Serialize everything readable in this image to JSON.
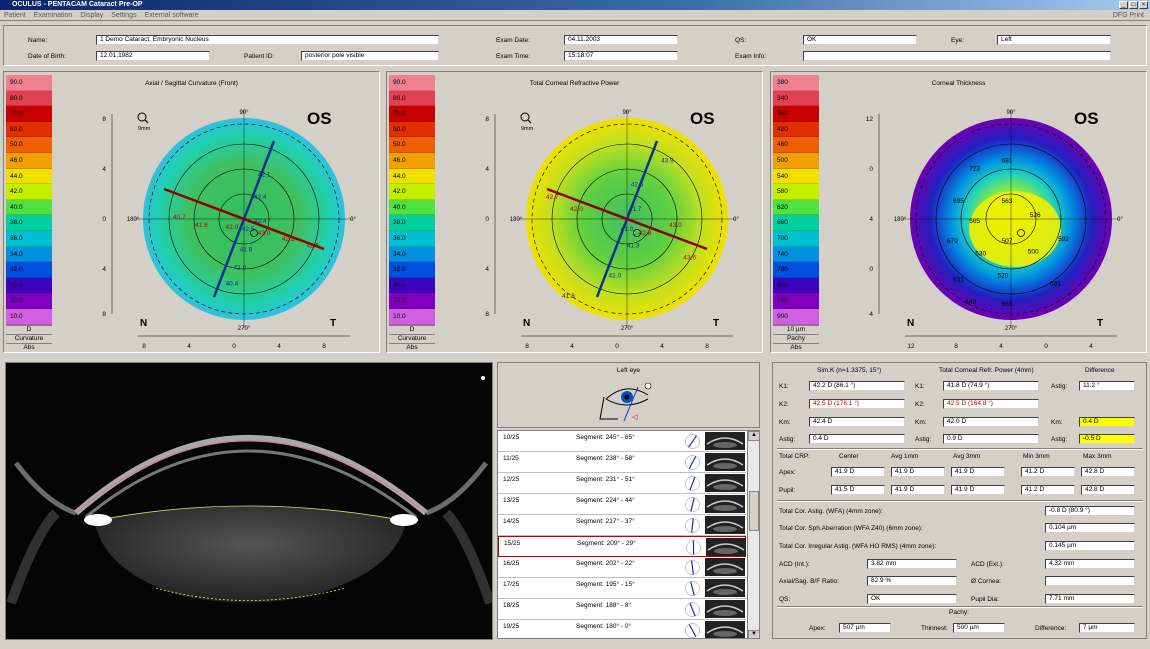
{
  "window": {
    "title": "OCULUS - PENTACAM  Cataract Pre-OP"
  },
  "menu": [
    "Patient",
    "Examination",
    "Display",
    "Settings",
    "External software"
  ],
  "menu_right": "DFG  Print",
  "header": {
    "name_label": "Name:",
    "name": "1 Demo Cataract, Embryonic Nucleus",
    "dob_label": "Date of Birth:",
    "dob": "12.01.1982",
    "pid_label": "Patient ID:",
    "pid": "posterior pole visible",
    "exam_date_label": "Exam Date:",
    "exam_date": "04.11.2003",
    "exam_time_label": "Exam Time:",
    "exam_time": "15:18:07",
    "qs_label": "QS:",
    "qs": "OK",
    "eye_label": "Eye:",
    "eye": "Left",
    "exam_info_label": "Exam Info:",
    "exam_info": ""
  },
  "maps": [
    {
      "title": "Axial / Sagittal Curvature (Front)",
      "os": "OS",
      "scale": [
        "90.0",
        "80.0",
        "70.0",
        "60.0",
        "50.0",
        "46.0",
        "44.0",
        "42.0",
        "40.0",
        "38.0",
        "36.0",
        "34.0",
        "32.0",
        "30.0",
        "20.0",
        "10.0"
      ],
      "foot": [
        "D",
        "Curvature",
        "Abs"
      ],
      "nasal": "N",
      "temporal": "T",
      "yticks": [
        "8",
        "4",
        "0",
        "4",
        "8"
      ],
      "xticks": [
        "8",
        "4",
        "0",
        "4",
        "8"
      ],
      "zoom": "9mm",
      "labels": [
        "42.1",
        "42.4",
        "42.4",
        "42.5",
        "41.8",
        "41.0",
        "40.4",
        "40.7",
        "41.6",
        "42.0",
        "43.0",
        "42.8",
        "42.5"
      ]
    },
    {
      "title": "Total Corneal Refractive Power",
      "os": "OS",
      "scale": [
        "90.0",
        "80.0",
        "70.0",
        "60.0",
        "50.0",
        "46.0",
        "44.0",
        "42.0",
        "40.0",
        "38.0",
        "36.0",
        "34.0",
        "32.0",
        "30.0",
        "20.0",
        "10.0"
      ],
      "foot": [
        "D",
        "Curvature",
        "Abs"
      ],
      "nasal": "N",
      "temporal": "T",
      "yticks": [
        "8",
        "4",
        "0",
        "4",
        "8"
      ],
      "xticks": [
        "8",
        "4",
        "0",
        "4",
        "8"
      ],
      "zoom": "9mm",
      "labels": [
        "43.9",
        "42.5",
        "41.7",
        "41.0",
        "42.8",
        "43.0",
        "41.3",
        "41.0",
        "41.8",
        "42.7",
        "42.0",
        "43.6"
      ]
    },
    {
      "title": "Corneal Thickness",
      "os": "OS",
      "scale": [
        "380",
        "340",
        "380",
        "420",
        "460",
        "500",
        "540",
        "580",
        "620",
        "660",
        "700",
        "740",
        "780",
        "820",
        "860",
        "900"
      ],
      "foot": [
        "10 µm",
        "Pachy",
        "Abs"
      ],
      "nasal": "N",
      "temporal": "T",
      "yticks": [
        "12",
        "0",
        "4",
        "0",
        "4",
        "8",
        "12"
      ],
      "xticks": [
        "12",
        "8",
        "4",
        "0",
        "4",
        "8",
        "12"
      ],
      "zoom": "",
      "labels": [
        "723",
        "681",
        "695",
        "563",
        "565",
        "526",
        "679",
        "507",
        "500",
        "592",
        "530",
        "520",
        "631",
        "649",
        "665",
        "691"
      ]
    }
  ],
  "eye_box": {
    "title": "Left eye"
  },
  "segments": [
    {
      "n": "10/25",
      "t": "Segment: 245° - 65°"
    },
    {
      "n": "11/25",
      "t": "Segment: 238° - 58°"
    },
    {
      "n": "12/25",
      "t": "Segment: 231° - 51°"
    },
    {
      "n": "13/25",
      "t": "Segment: 224° - 44°"
    },
    {
      "n": "14/25",
      "t": "Segment: 217° - 37°"
    },
    {
      "n": "15/25",
      "t": "Segment: 209° - 29°"
    },
    {
      "n": "16/25",
      "t": "Segment: 202° - 22°"
    },
    {
      "n": "17/25",
      "t": "Segment: 195° - 15°"
    },
    {
      "n": "18/25",
      "t": "Segment: 188° - 8°"
    },
    {
      "n": "19/25",
      "t": "Segment: 180° - 0°"
    }
  ],
  "selected_segment": 5,
  "results": {
    "col1": "Sim.K (n=1.3375, 15°)",
    "col2": "Total Corneal Refr. Power (4mm)",
    "col3": "Difference",
    "k1_lbl": "K1:",
    "k1": "42.2 D (86.1 °)",
    "tk1": "41.8 D (74.9 °)",
    "astig_lbl": "Astig:",
    "d_astig": "11.2 °",
    "k2_lbl": "K2:",
    "k2": "42.5 D (176.1 °)",
    "tk2": "42.5 D (164.8 °)",
    "km_lbl": "Km:",
    "km": "42.4 D",
    "tkm": "42.0 D",
    "d_km": "0.4 D",
    "astig_lbl2": "Astig:",
    "astig": "0.4 D",
    "tastig": "0.9 D",
    "d_astig2": "-0.5 D",
    "crp_lbl": "Total CRP:",
    "center": "Center",
    "avg1": "Avg 1mm",
    "avg3": "Avg 3mm",
    "min3": "Min 3mm",
    "max3": "Max 3mm",
    "apex_lbl": "Apex:",
    "apex": [
      "41.9 D",
      "41.9 D",
      "41.9 D",
      "41.2 D",
      "42.8 D"
    ],
    "pupil_lbl": "Pupil:",
    "pupil": [
      "41.5 D",
      "41.9 D",
      "41.9 D",
      "41.2 D",
      "42.8 D"
    ],
    "tca_lbl": "Total Cor. Astig. (WFA) (4mm zone):",
    "tca": "-0.8 D (80.9 °)",
    "tsa_lbl": "Total Cor. Sph.Aberration (WFA Z40) (6mm zone):",
    "tsa": "0.104 µm",
    "tia_lbl": "Total Cor. Irregular Astig. (WFA HO RMS) (4mm zone):",
    "tia": "0.145 µm",
    "acd_int_lbl": "ACD (Int.):",
    "acd_int": "3.82 mm",
    "acd_ext_lbl": "ACD (Ext.):",
    "acd_ext": "4.32 mm",
    "ratio_lbl": "Axial/Sag. B/F Ratio:",
    "ratio": "82.9 %",
    "cornea_lbl": "Ø Cornea:",
    "cornea": "",
    "qs_lbl": "QS:",
    "qs": "OK",
    "pupil_dia_lbl": "Pupil Dia:",
    "pupil_dia": "7.71 mm",
    "pachy_lbl": "Pachy:",
    "papex_lbl": "Apex:",
    "papex": "507 µm",
    "thin_lbl": "Thinnest:",
    "thin": "500 µm",
    "diff_lbl": "Difference:",
    "diff": "7 µm"
  },
  "colors": {
    "scale_curv": [
      "#f08090",
      "#e04050",
      "#c80000",
      "#e03000",
      "#f06000",
      "#f0a000",
      "#f0e000",
      "#c0f000",
      "#50e040",
      "#00d0a0",
      "#00c0d0",
      "#0090e0",
      "#0050e0",
      "#4000c0",
      "#8000c0",
      "#d060e0"
    ],
    "scale_pachy": [
      "#f08090",
      "#e04050",
      "#c80000",
      "#e03000",
      "#f06000",
      "#f0a000",
      "#f0e000",
      "#c0f000",
      "#50e040",
      "#00d0a0",
      "#00c0d0",
      "#0090e0",
      "#0050e0",
      "#4000c0",
      "#8000c0",
      "#d060e0"
    ]
  }
}
